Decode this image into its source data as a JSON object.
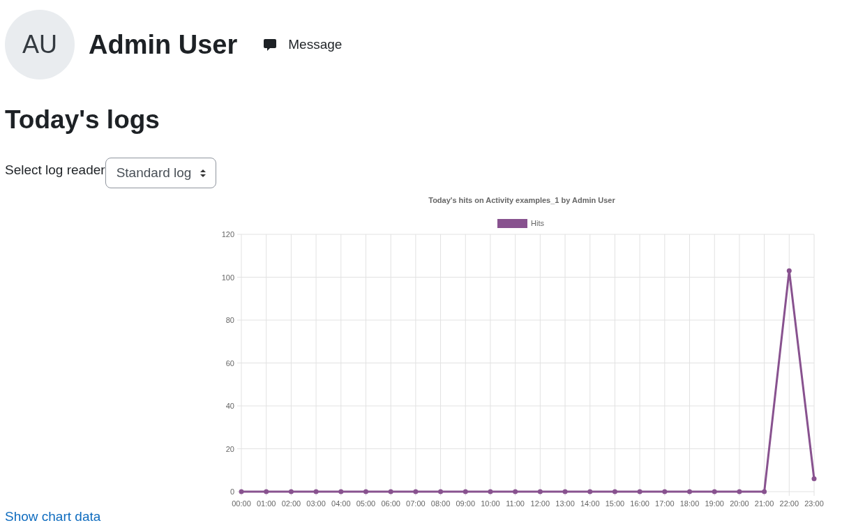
{
  "profile": {
    "initials": "AU",
    "name": "Admin User",
    "message_link": "Message"
  },
  "heading": "Today's logs",
  "log_reader": {
    "label": "Select log reader",
    "value": "Standard log"
  },
  "chart": {
    "chart_data": {
      "type": "line",
      "title": "Today's hits on Activity examples_1 by Admin User",
      "categories": [
        "00:00",
        "01:00",
        "02:00",
        "03:00",
        "04:00",
        "05:00",
        "06:00",
        "07:00",
        "08:00",
        "09:00",
        "10:00",
        "11:00",
        "12:00",
        "13:00",
        "14:00",
        "15:00",
        "16:00",
        "17:00",
        "18:00",
        "19:00",
        "20:00",
        "21:00",
        "22:00",
        "23:00"
      ],
      "grid": true,
      "series": [
        {
          "name": "Hits",
          "color": "#88528f",
          "marker": true,
          "values": [
            0,
            0,
            0,
            0,
            0,
            0,
            0,
            0,
            0,
            0,
            0,
            0,
            0,
            0,
            0,
            0,
            0,
            0,
            0,
            0,
            0,
            0,
            103,
            6
          ]
        }
      ],
      "ylim": [
        0,
        120
      ],
      "yticks": [
        0,
        20,
        40,
        60,
        80,
        100,
        120
      ]
    }
  },
  "show_chart_data": "Show chart data"
}
